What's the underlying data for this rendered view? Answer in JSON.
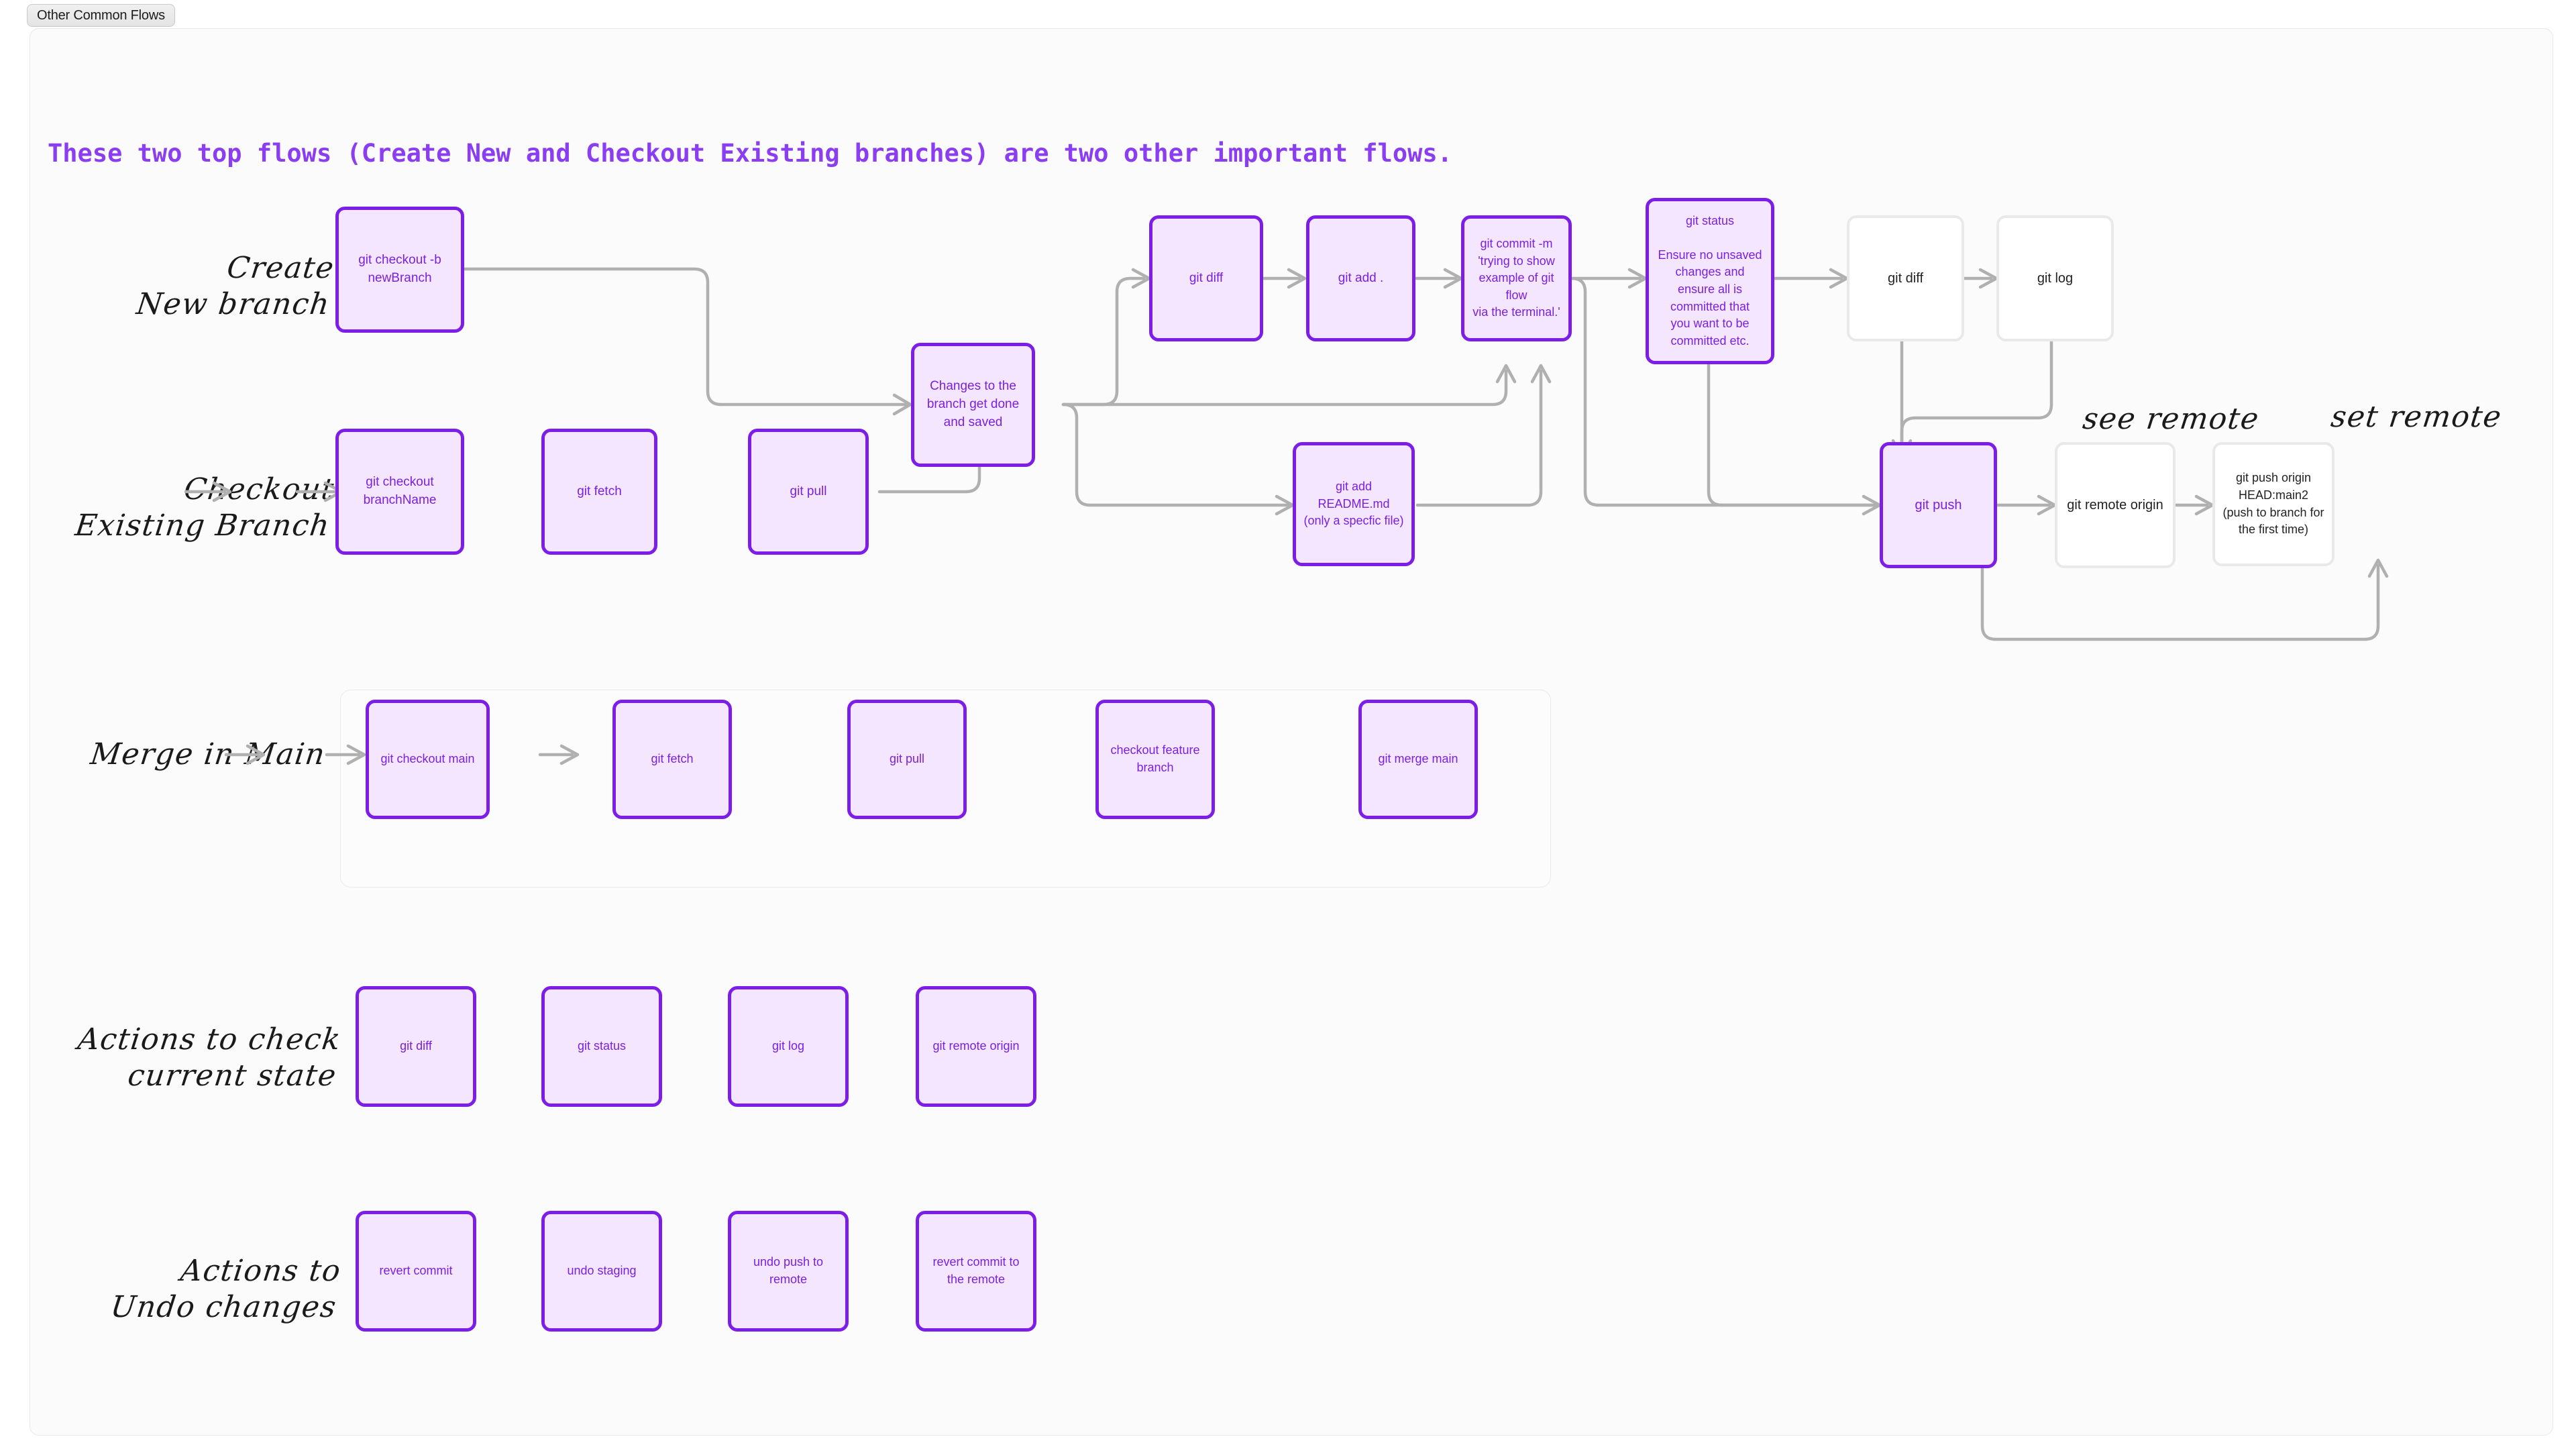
{
  "tab": {
    "label": "Other Common Flows"
  },
  "headline": "These two top flows (Create New and Checkout Existing branches) are two other important flows.",
  "labels": {
    "create_new_branch": "Create\nNew branch",
    "checkout_existing_branch": "Checkout\nExisting Branch",
    "see_remote": "see remote",
    "set_remote": "set remote",
    "merge_in_main": "Merge in Main",
    "actions_check_state": "Actions to check\ncurrent state",
    "actions_undo_changes": "Actions to\nUndo changes"
  },
  "nodes": {
    "checkout_b_new": "git checkout -b\nnewBranch",
    "checkout_branchname": "git checkout\nbranchName",
    "fetch_top": "git fetch",
    "pull_top": "git pull",
    "changes_done": "Changes to the\nbranch get done\nand saved",
    "diff_top": "git diff",
    "add_dot": "git add .",
    "add_readme": "git add\nREADME.md\n(only a specfic file)",
    "commit_m": "git commit -m\n'trying to show\nexample of git flow\nvia the terminal.'",
    "status_ensure": "git status\n\nEnsure no unsaved\nchanges and\nensure all is\ncommitted that\nyou want to be\ncommitted etc.",
    "diff_white": "git diff",
    "log_white": "git log",
    "push": "git push",
    "remote_origin_white": "git remote origin",
    "push_origin_head": "git push origin\nHEAD:main2\n(push to branch for\nthe first time)"
  },
  "merge_row": [
    "git checkout main",
    "git fetch",
    "git pull",
    "checkout feature\nbranch",
    "git merge main"
  ],
  "check_state_row": [
    "git diff",
    "git status",
    "git log",
    "git remote origin"
  ],
  "undo_row": [
    "revert commit",
    "undo staging",
    "undo push to\nremote",
    "revert commit to\nthe remote"
  ],
  "colors": {
    "accent_purple": "#7c1ee8",
    "node_fill": "#f3e6fe",
    "node_text": "#7b1fe0",
    "edge_gray": "#b0b0b0",
    "white_node_border": "#e9e9e9",
    "canvas_bg": "#fbfbfb"
  }
}
